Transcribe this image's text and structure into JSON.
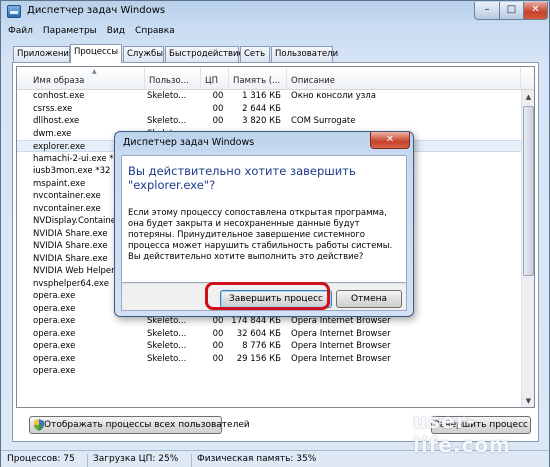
{
  "window": {
    "title": "Диспетчер задач Windows",
    "min": "–",
    "max": "□",
    "close": "✕"
  },
  "menu": [
    "Файл",
    "Параметры",
    "Вид",
    "Справка"
  ],
  "tabs": [
    "Приложения",
    "Процессы",
    "Службы",
    "Быстродействие",
    "Сеть",
    "Пользователи"
  ],
  "active_tab": "Процессы",
  "columns": [
    "Имя образа",
    "Пользо...",
    "ЦП",
    "Память (...",
    "Описание"
  ],
  "rows": [
    [
      "conhost.exe",
      "Skeleto...",
      "00",
      "1 316 КБ",
      "Окно консоли узла"
    ],
    [
      "csrss.exe",
      "",
      "00",
      "2 644 КБ",
      ""
    ],
    [
      "dllhost.exe",
      "Skeleto...",
      "00",
      "3 820 КБ",
      "COM Surrogate"
    ],
    [
      "dwm.exe",
      "Skeleto...",
      "",
      "",
      ""
    ],
    [
      "explorer.exe",
      "",
      "",
      "",
      ""
    ],
    [
      "hamachi-2-ui.exe *32",
      "",
      "",
      "",
      ""
    ],
    [
      "iusb3mon.exe *32",
      "",
      "",
      "",
      ""
    ],
    [
      "mspaint.exe",
      "",
      "",
      "",
      ""
    ],
    [
      "nvcontainer.exe",
      "",
      "",
      "",
      ""
    ],
    [
      "nvcontainer.exe",
      "",
      "",
      "",
      ""
    ],
    [
      "NVDisplay.Container.exe",
      "",
      "",
      "",
      ""
    ],
    [
      "NVIDIA Share.exe",
      "",
      "",
      "",
      ""
    ],
    [
      "NVIDIA Share.exe",
      "",
      "",
      "",
      ""
    ],
    [
      "NVIDIA Share.exe",
      "",
      "",
      "",
      ""
    ],
    [
      "NVIDIA Web Helper.exe",
      "",
      "",
      "",
      ""
    ],
    [
      "nvsphelper64.exe",
      "",
      "",
      "",
      ""
    ],
    [
      "opera.exe",
      "Skeleto...",
      "00",
      "22 580 КБ",
      "Opera Internet Browser"
    ],
    [
      "opera.exe",
      "Skeleto...",
      "00",
      "7 320 КБ",
      "Opera Internet Browser"
    ],
    [
      "opera.exe",
      "Skeleto...",
      "00",
      "174 844 КБ",
      "Opera Internet Browser"
    ],
    [
      "opera.exe",
      "Skeleto...",
      "00",
      "32 604 КБ",
      "Opera Internet Browser"
    ],
    [
      "opera.exe",
      "Skeleto...",
      "00",
      "8 776 КБ",
      "Opera Internet Browser"
    ],
    [
      "opera.exe",
      "Skeleto...",
      "00",
      "29 156 КБ",
      "Opera Internet Browser"
    ],
    [
      "opera.exe",
      "",
      "",
      "",
      ""
    ]
  ],
  "selected_row": 4,
  "buttons": {
    "show_all": "Отображать процессы всех пользователей",
    "end_process": "Завершить процесс"
  },
  "status": {
    "processes": "Процессов: 75",
    "cpu": "Загрузка ЦП: 25%",
    "memory": "Физическая память: 35%"
  },
  "dialog": {
    "title": "Диспетчер задач Windows",
    "close": "✕",
    "heading": "Вы действительно хотите завершить \"explorer.exe\"?",
    "text": "Если этому процессу сопоставлена открытая программа, она будет закрыта и несохраненные данные будут потеряны. Принудительное завершение системного процесса может нарушить стабильность работы системы. Вы действительно хотите выполнить это действие?",
    "confirm": "Завершить процесс",
    "cancel": "Отмена"
  },
  "watermark": "user-life.com",
  "colors": {
    "highlight": "#d10f1a",
    "dialog_heading": "#1c3a8a",
    "title_gradient": "#b9d1ea"
  }
}
